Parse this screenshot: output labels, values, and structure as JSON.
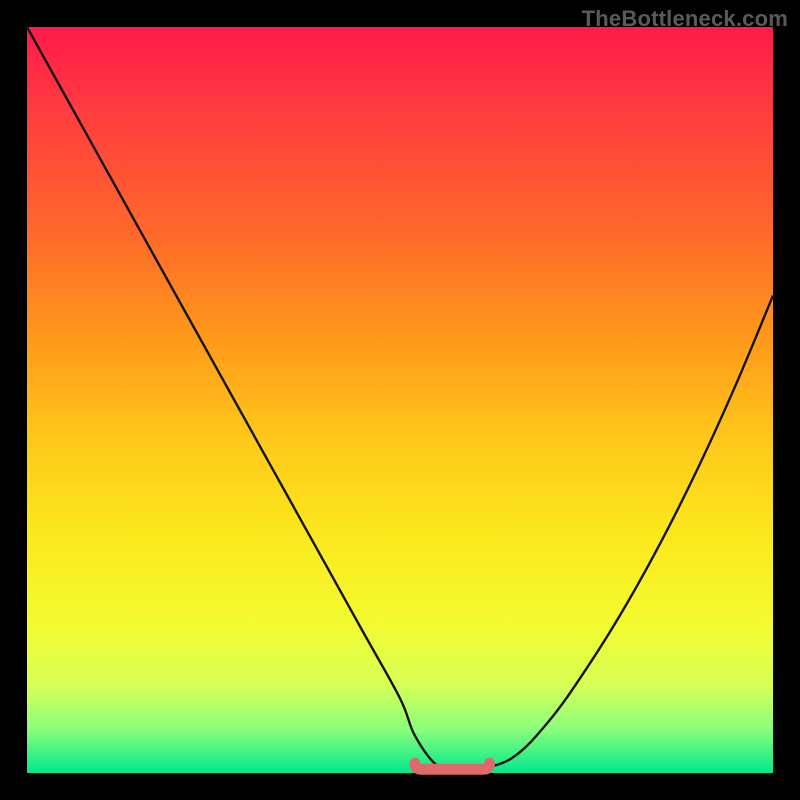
{
  "watermark": "TheBottleneck.com",
  "colors": {
    "black": "#000000",
    "marker": "#e06a6a",
    "curve": "#1a1a1a",
    "gradient_top": "#ff1a4a",
    "gradient_bottom": "#00e88c"
  },
  "chart_data": {
    "type": "line",
    "title": "",
    "xlabel": "",
    "ylabel": "",
    "xlim": [
      0,
      100
    ],
    "ylim": [
      0,
      100
    ],
    "grid": false,
    "legend": false,
    "x": [
      0,
      5,
      10,
      15,
      20,
      25,
      30,
      35,
      40,
      45,
      50,
      52,
      55,
      58,
      60,
      65,
      70,
      75,
      80,
      85,
      90,
      95,
      100
    ],
    "series": [
      {
        "name": "bottleneck-curve",
        "values": [
          100,
          91,
          82,
          73,
          64,
          55,
          46,
          37,
          28,
          19,
          10,
          5,
          1,
          0.5,
          0.5,
          2,
          7,
          14,
          22,
          31,
          41,
          52,
          64
        ]
      }
    ],
    "annotations": [
      {
        "name": "flat-minimum-marker",
        "type": "segment",
        "x_range": [
          52,
          62
        ],
        "y": 0.5,
        "color": "#e06a6a"
      }
    ]
  }
}
